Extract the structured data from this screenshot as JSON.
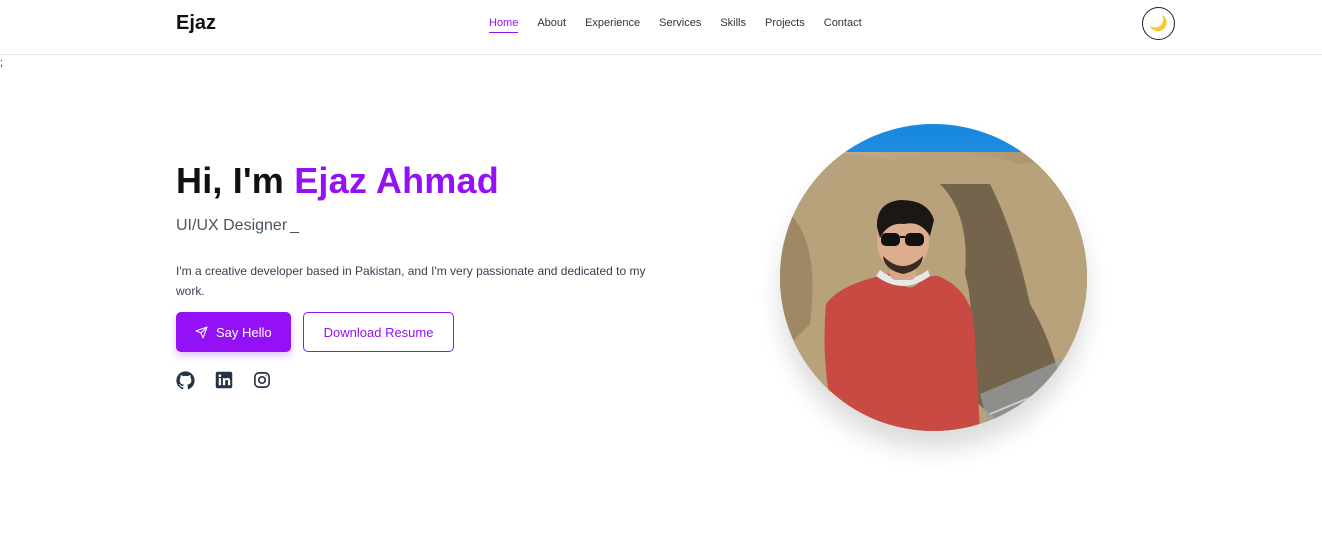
{
  "nav": {
    "brand": "Ejaz",
    "links": [
      "Home",
      "About",
      "Experience",
      "Services",
      "Skills",
      "Projects",
      "Contact"
    ],
    "active_link": "Home",
    "theme_toggle_icon": "moon-icon"
  },
  "stray_text": ";",
  "hero": {
    "greeting": "Hi, I'm",
    "name": "Ejaz Ahmad",
    "role": "UI/UX Designer",
    "caret": "_",
    "intro": "I'm a creative developer based in Pakistan, and I'm very passionate and dedicated to my work.",
    "primary_button": "Say Hello",
    "primary_button_icon": "paper-plane-icon",
    "secondary_button": "Download Resume",
    "social_icons": [
      "github-icon",
      "linkedin-icon",
      "instagram-icon"
    ],
    "portrait": "profile-photo"
  },
  "colors": {
    "accent": "#9410f5",
    "text": "#111111",
    "muted": "#4b5563",
    "border": "#e5e7eb"
  }
}
